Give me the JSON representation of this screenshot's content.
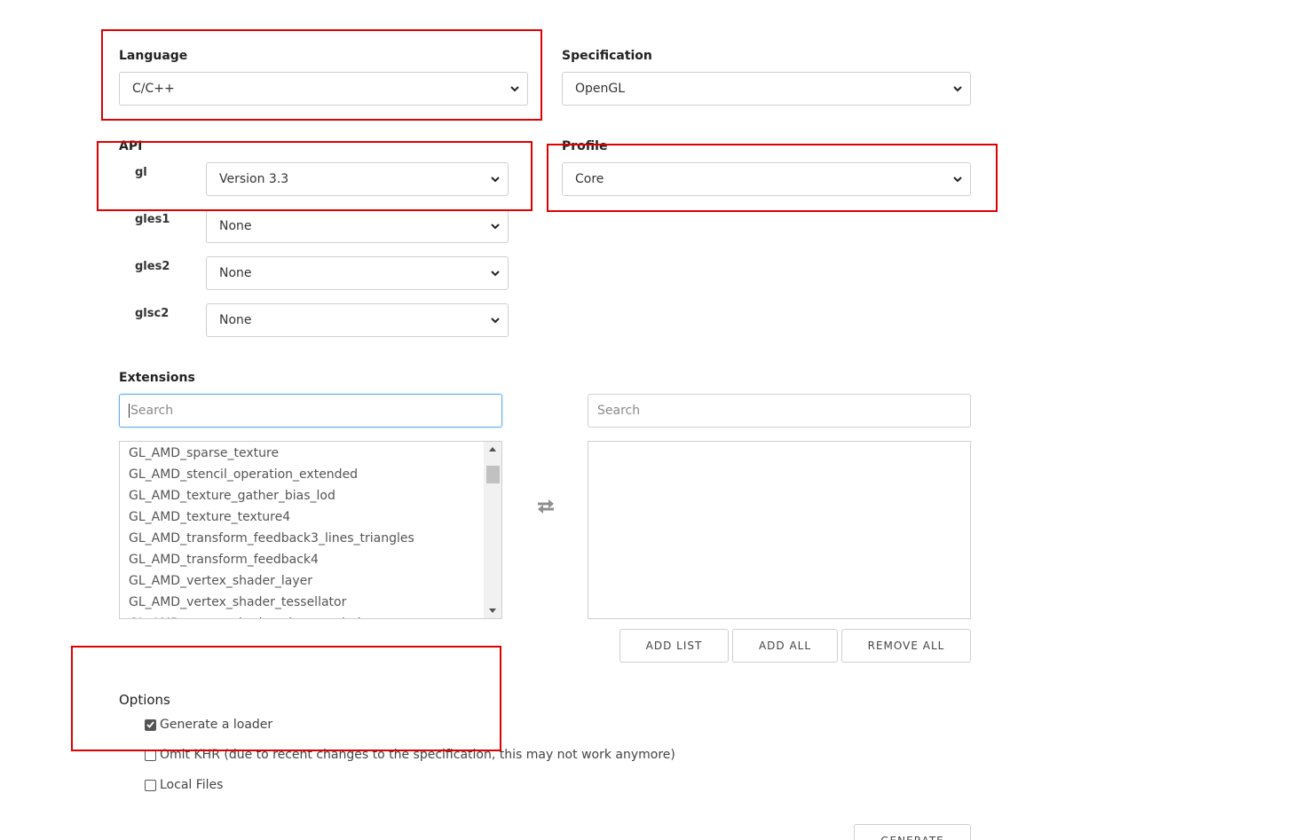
{
  "language": {
    "label": "Language",
    "selected": "C/C++"
  },
  "specification": {
    "label": "Specification",
    "selected": "OpenGL"
  },
  "api": {
    "label": "API",
    "rows": [
      {
        "name": "gl",
        "selected": "Version 3.3"
      },
      {
        "name": "gles1",
        "selected": "None"
      },
      {
        "name": "gles2",
        "selected": "None"
      },
      {
        "name": "glsc2",
        "selected": "None"
      }
    ]
  },
  "profile": {
    "label": "Profile",
    "selected": "Core"
  },
  "extensions": {
    "label": "Extensions",
    "left_search_placeholder": "Search",
    "right_search_placeholder": "Search",
    "available": [
      "GL_AMD_sparse_texture",
      "GL_AMD_stencil_operation_extended",
      "GL_AMD_texture_gather_bias_lod",
      "GL_AMD_texture_texture4",
      "GL_AMD_transform_feedback3_lines_triangles",
      "GL_AMD_transform_feedback4",
      "GL_AMD_vertex_shader_layer",
      "GL_AMD_vertex_shader_tessellator",
      "GL_AMD_vertex_shader_viewport_index"
    ],
    "add_list_label": "ADD LIST",
    "add_all_label": "ADD ALL",
    "remove_all_label": "REMOVE ALL"
  },
  "options": {
    "label": "Options",
    "items": [
      {
        "label": "Generate a loader",
        "checked": true
      },
      {
        "label": "Omit KHR (due to recent changes to the specification, this may not work anymore)",
        "checked": false
      },
      {
        "label": "Local Files",
        "checked": false
      }
    ]
  },
  "generate_label": "GENERATE",
  "colors": {
    "highlight": "#e00000",
    "focus": "#66afe9"
  }
}
